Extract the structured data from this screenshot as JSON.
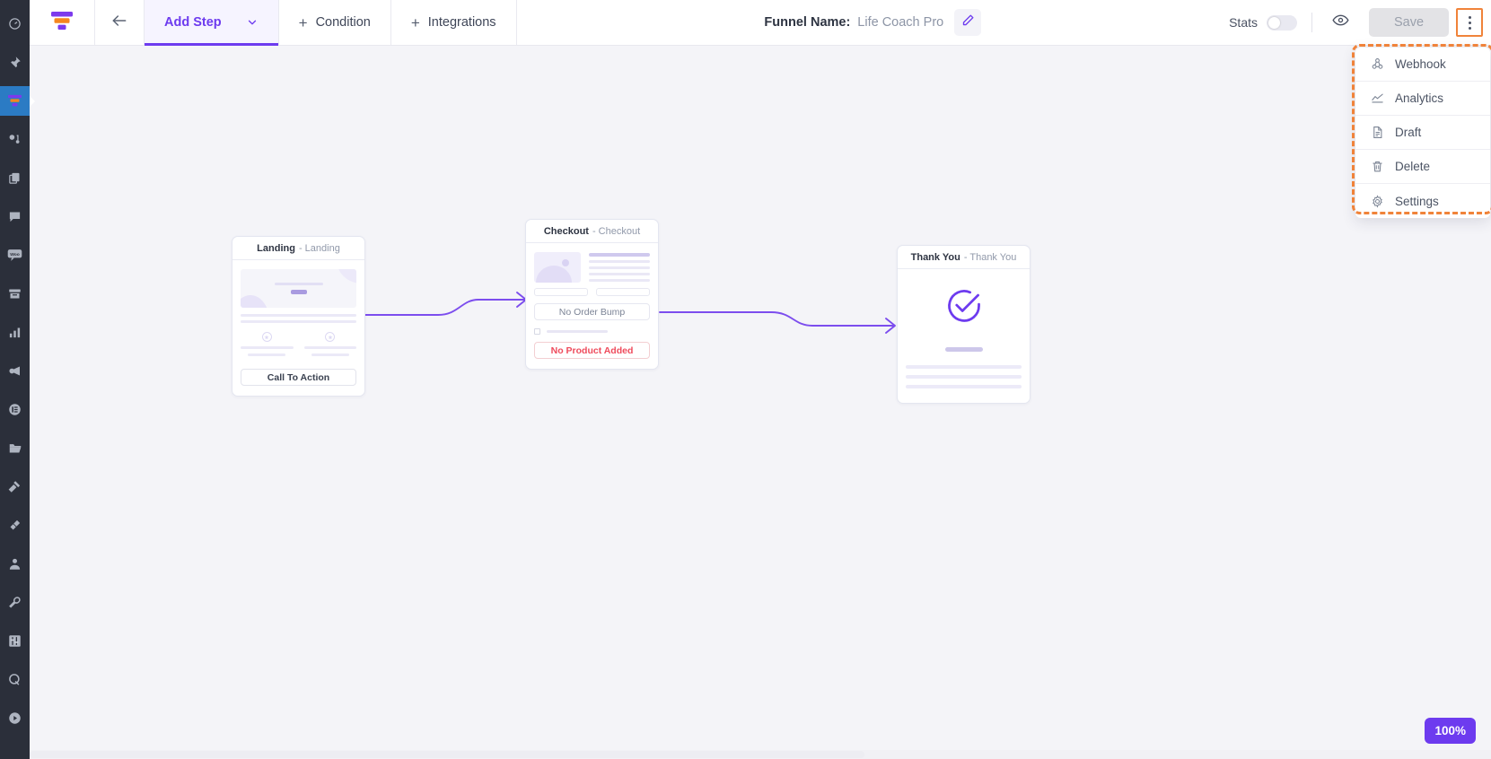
{
  "rail": {
    "items": [
      {
        "name": "dashboard",
        "icon": "gauge-icon",
        "active": false
      },
      {
        "name": "pin",
        "icon": "pin-icon",
        "active": false
      },
      {
        "name": "funnels",
        "icon": "funnel-icon",
        "active": true
      },
      {
        "name": "automations",
        "icon": "nodes-icon",
        "active": false
      },
      {
        "name": "templates",
        "icon": "copy-icon",
        "active": false
      },
      {
        "name": "messages",
        "icon": "chat-bubble-icon",
        "active": false
      },
      {
        "name": "woo",
        "icon": "woo-icon",
        "active": false
      },
      {
        "name": "archive",
        "icon": "archive-icon",
        "active": false
      },
      {
        "name": "reports",
        "icon": "bar-chart-icon",
        "active": false
      },
      {
        "name": "marketing",
        "icon": "megaphone-icon",
        "active": false
      },
      {
        "name": "list",
        "icon": "list-circle-icon",
        "active": false
      },
      {
        "name": "files",
        "icon": "folder-icon",
        "active": false
      },
      {
        "name": "builder",
        "icon": "hammer-icon",
        "active": false
      },
      {
        "name": "plugins",
        "icon": "plug-icon",
        "active": false
      },
      {
        "name": "users",
        "icon": "user-icon",
        "active": false
      },
      {
        "name": "tools",
        "icon": "wrench-icon",
        "active": false
      },
      {
        "name": "settings",
        "icon": "sliders-icon",
        "active": false
      },
      {
        "name": "queue",
        "icon": "q-icon",
        "active": false
      },
      {
        "name": "play",
        "icon": "play-circle-icon",
        "active": false
      }
    ]
  },
  "topbar": {
    "logo_alt": "funnel-logo",
    "back_label": "back-arrow-icon",
    "tabs": [
      {
        "label": "Add Step",
        "active": true,
        "has_chevron": true,
        "has_plus": false
      },
      {
        "label": "Condition",
        "active": false,
        "has_chevron": false,
        "has_plus": true
      },
      {
        "label": "Integrations",
        "active": false,
        "has_chevron": false,
        "has_plus": true
      }
    ],
    "funnel_name_label": "Funnel Name:",
    "funnel_name_value": "Life Coach Pro",
    "edit_icon": "pencil-icon",
    "stats_label": "Stats",
    "stats_enabled": false,
    "preview_icon": "eye-icon",
    "save_label": "Save",
    "kebab_icon": "three-dots-vertical-icon"
  },
  "menu": {
    "items": [
      {
        "label": "Webhook",
        "icon": "webhook-icon"
      },
      {
        "label": "Analytics",
        "icon": "line-chart-icon"
      },
      {
        "label": "Draft",
        "icon": "document-icon"
      },
      {
        "label": "Delete",
        "icon": "trash-icon"
      },
      {
        "label": "Settings",
        "icon": "gear-icon"
      }
    ]
  },
  "canvas": {
    "steps": [
      {
        "id": "landing",
        "title": "Landing",
        "subtitle": "- Landing",
        "cta_label": "Call To Action"
      },
      {
        "id": "checkout",
        "title": "Checkout",
        "subtitle": "- Checkout",
        "order_bump_label": "No Order Bump",
        "product_label": "No Product Added"
      },
      {
        "id": "thankyou",
        "title": "Thank You",
        "subtitle": "- Thank You",
        "check_icon": "check-circle-icon"
      }
    ]
  },
  "zoom": {
    "level": "100%"
  },
  "colors": {
    "accent": "#6d3bef",
    "highlight": "#f0833a",
    "danger": "#ef4b5c",
    "rail_bg": "#2b2f3a",
    "canvas_bg": "#f4f4f8"
  }
}
